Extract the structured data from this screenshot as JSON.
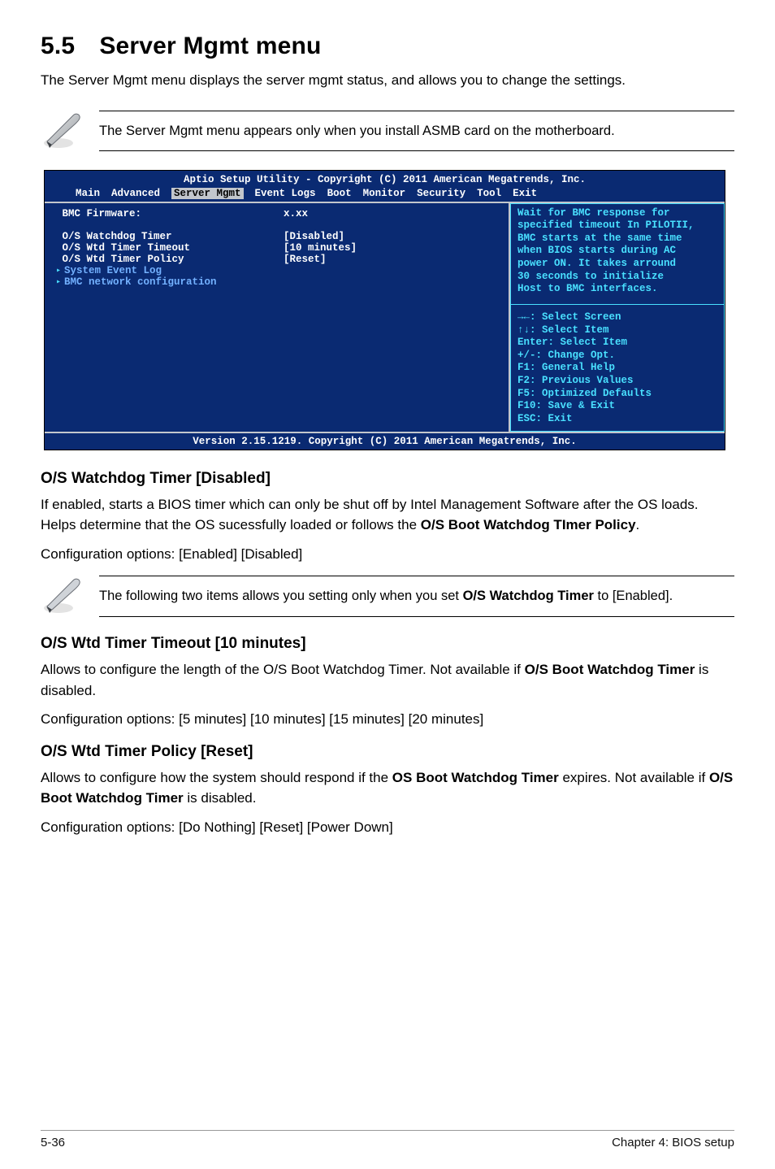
{
  "section": {
    "number": "5.5",
    "title": "Server Mgmt menu"
  },
  "intro": "The Server Mgmt menu displays the server mgmt status, and allows you to change the settings.",
  "note1": "The Server Mgmt menu appears only when you install ASMB card on the motherboard.",
  "bios": {
    "header_line1": "Aptio Setup Utility - Copyright (C) 2011 American Megatrends, Inc.",
    "tabs": [
      "Main",
      "Advanced",
      "Server Mgmt",
      "Event Logs",
      "Boot",
      "Monitor",
      "Security",
      "Tool",
      "Exit"
    ],
    "active_tab_index": 2,
    "rows": [
      {
        "k": "BMC Firmware:",
        "v": "x.xx"
      },
      {
        "k": "",
        "v": ""
      },
      {
        "k": "O/S Watchdog Timer",
        "v": "[Disabled]"
      },
      {
        "k": "O/S Wtd Timer Timeout",
        "v": "[10 minutes]"
      },
      {
        "k": "O/S Wtd Timer Policy",
        "v": "[Reset]"
      }
    ],
    "links": [
      "System Event Log",
      "BMC network configuration"
    ],
    "help_top": [
      "Wait for BMC response for",
      "specified timeout In PILOTII,",
      "BMC starts at the same time",
      "when BIOS starts during AC",
      "power ON. It takes arround",
      "30 seconds to initialize",
      "Host to BMC interfaces."
    ],
    "help_bottom": [
      "→←: Select Screen",
      "↑↓:  Select Item",
      "Enter: Select Item",
      "+/-: Change Opt.",
      "F1: General Help",
      "F2: Previous Values",
      "F5: Optimized Defaults",
      "F10: Save & Exit",
      "ESC: Exit"
    ],
    "footer": "Version 2.15.1219. Copyright (C) 2011 American Megatrends, Inc."
  },
  "sub1": {
    "heading": "O/S Watchdog Timer [Disabled]",
    "body_html": "If enabled, starts a BIOS timer which can only be shut off by Intel Management Software after the OS loads. Helps determine that the OS sucessfully loaded or follows the ",
    "body_strong": "O/S Boot Watchdog TImer Policy",
    "body_tail": ".",
    "config": "Configuration options: [Enabled] [Disabled]"
  },
  "note2_pre": "The following two items allows you setting only when you set ",
  "note2_strong": "O/S Watchdog Timer",
  "note2_post": " to [Enabled].",
  "sub2": {
    "heading": "O/S Wtd Timer Timeout [10 minutes]",
    "body_pre": "Allows to configure the length of the O/S Boot Watchdog Timer. Not available if ",
    "body_strong": "O/S Boot Watchdog Timer",
    "body_post": " is disabled.",
    "config": "Configuration options: [5 minutes] [10 minutes] [15 minutes] [20 minutes]"
  },
  "sub3": {
    "heading": "O/S Wtd Timer Policy [Reset]",
    "body_pre": "Allows to configure how the system should respond if the ",
    "body_strong": "OS Boot Watchdog Timer",
    "body_mid": " expires. Not available if ",
    "body_strong2": "O/S Boot Watchdog Timer",
    "body_post": " is disabled.",
    "config": "Configuration options: [Do Nothing] [Reset] [Power Down]"
  },
  "footer": {
    "left": "5-36",
    "right": "Chapter 4: BIOS setup"
  }
}
